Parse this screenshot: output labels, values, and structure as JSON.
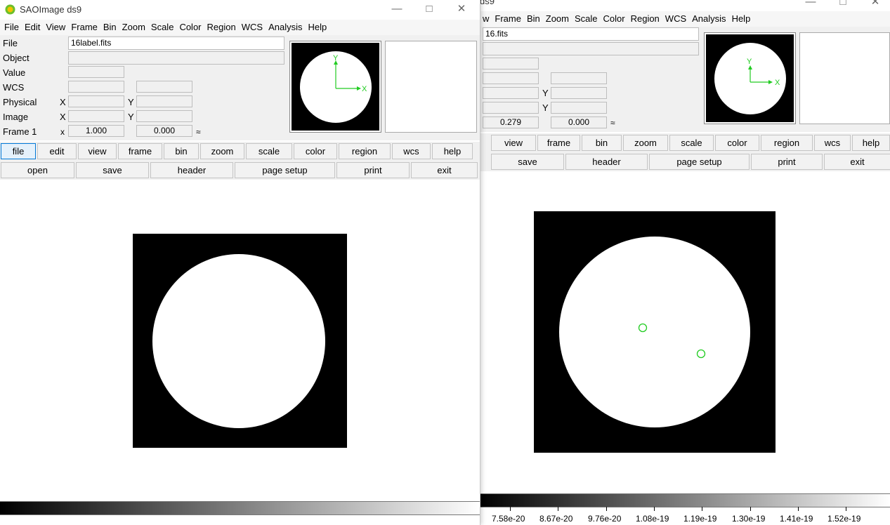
{
  "back_window": {
    "title": "ds9",
    "menu": [
      "w",
      "Frame",
      "Bin",
      "Zoom",
      "Scale",
      "Color",
      "Region",
      "WCS",
      "Analysis",
      "Help"
    ],
    "info": {
      "file_value": "16.fits",
      "frame_x_value": "0.279",
      "frame_y_value": "0.000",
      "y_label": "Y",
      "zoom_unit": "≈"
    },
    "panner": {
      "x_label": "X",
      "y_label": "Y"
    },
    "buttons_row1": [
      "view",
      "frame",
      "bin",
      "zoom",
      "scale",
      "color",
      "region",
      "wcs",
      "help"
    ],
    "buttons_row2": [
      "save",
      "header",
      "page setup",
      "print",
      "exit"
    ],
    "colorbar_labels": [
      "7.58e-20",
      "8.67e-20",
      "9.76e-20",
      "1.08e-19",
      "1.19e-19",
      "1.30e-19",
      "1.41e-19",
      "1.52e-19"
    ]
  },
  "front_window": {
    "title": "SAOImage ds9",
    "menu": [
      "File",
      "Edit",
      "View",
      "Frame",
      "Bin",
      "Zoom",
      "Scale",
      "Color",
      "Region",
      "WCS",
      "Analysis",
      "Help"
    ],
    "info": {
      "file_label": "File",
      "file_value": "16label.fits",
      "object_label": "Object",
      "value_label": "Value",
      "wcs_label": "WCS",
      "physical_label": "Physical",
      "image_label": "Image",
      "frame_label": "Frame 1",
      "x_label": "X",
      "y_label": "Y",
      "frame_x_label": "x",
      "frame_x_value": "1.000",
      "frame_y_value": "0.000",
      "zoom_unit": "≈"
    },
    "panner": {
      "x_label": "X",
      "y_label": "Y"
    },
    "buttons_row1": [
      "file",
      "edit",
      "view",
      "frame",
      "bin",
      "zoom",
      "scale",
      "color",
      "region",
      "wcs",
      "help"
    ],
    "buttons_row2": [
      "open",
      "save",
      "header",
      "page setup",
      "print",
      "exit"
    ],
    "active_button": "file"
  },
  "colors": {
    "accent": "#0078d7",
    "region": "#22cc22",
    "logo_outer": "#6cbf2a",
    "logo_inner": "#f2c200"
  }
}
